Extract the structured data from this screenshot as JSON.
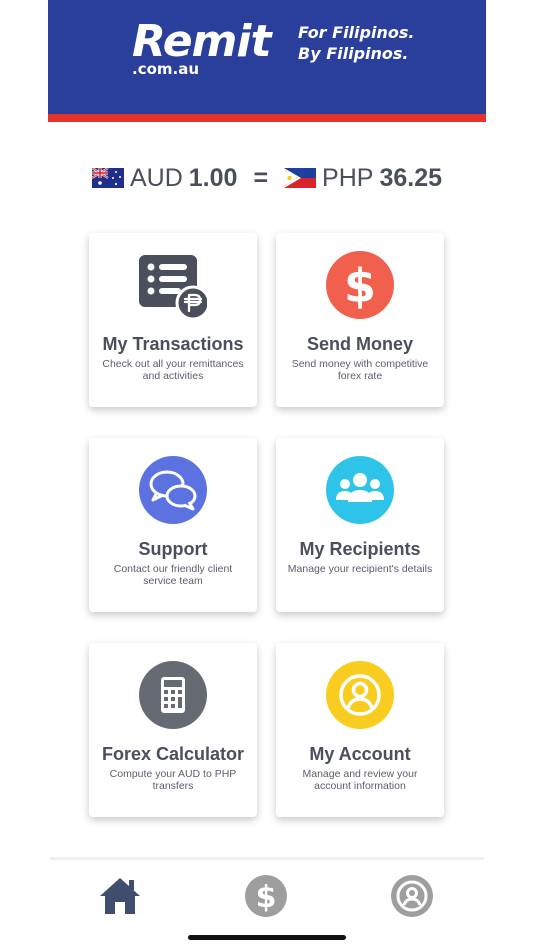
{
  "header": {
    "logo_text": "Remit",
    "logo_domain": ".com.au",
    "tagline_line1": "For Filipinos.",
    "tagline_line2": "By Filipinos.",
    "brand_color": "#2a3e9c",
    "accent_color": "#e8332b"
  },
  "rate": {
    "from_currency": "AUD",
    "from_amount": "1.00",
    "equals": "=",
    "to_currency": "PHP",
    "to_amount": "36.25"
  },
  "cards": [
    {
      "title": "My Transactions",
      "desc": "Check out all your remittances and activities",
      "icon": "transactions-list-icon",
      "color": "#4a4f5c"
    },
    {
      "title": "Send Money",
      "desc": "Send money with competitive forex rate",
      "icon": "dollar-icon",
      "color": "#f0604d"
    },
    {
      "title": "Support",
      "desc": "Contact our friendly client service team",
      "icon": "chat-bubbles-icon",
      "color": "#5b72e0"
    },
    {
      "title": "My Recipients",
      "desc": "Manage your recipient's details",
      "icon": "group-icon",
      "color": "#2ec4ea"
    },
    {
      "title": "Forex Calculator",
      "desc": "Compute your AUD to PHP transfers",
      "icon": "calculator-icon",
      "color": "#666a73"
    },
    {
      "title": "My Account",
      "desc": "Manage and review your account information",
      "icon": "user-icon",
      "color": "#f8cd20"
    }
  ],
  "nav": {
    "home_icon": "home-icon",
    "money_icon": "dollar-icon",
    "account_icon": "user-icon",
    "active_color": "#3f4d6e",
    "inactive_color": "#9e9e9e"
  }
}
